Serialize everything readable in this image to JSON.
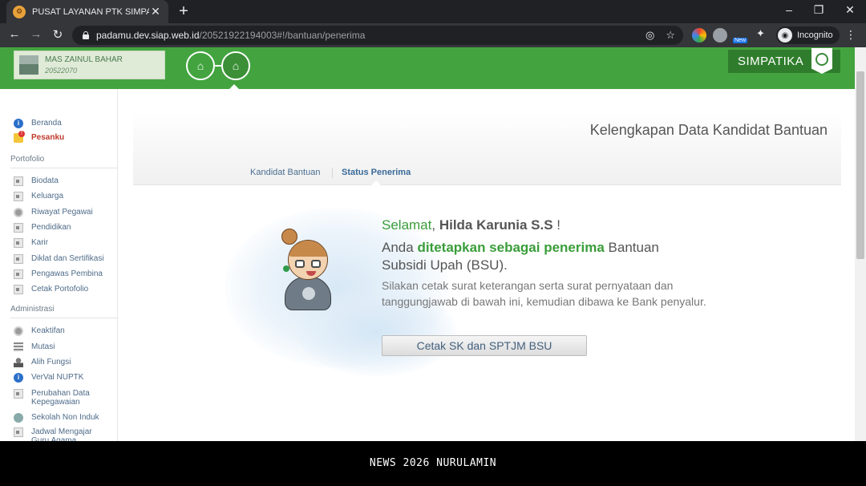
{
  "browser": {
    "tab_title": "PUSAT LAYANAN PTK SIMPATIKA",
    "favicon": "simpatika-favicon",
    "url_host": "padamu.dev.siap.web.id",
    "url_path": "/20521922194003#!/bantuan/penerima",
    "ext_badge": "New",
    "incognito_label": "Incognito"
  },
  "header": {
    "user_name": "MAS ZAINUL BAHAR",
    "user_id": "20522070",
    "brand": "SIMPATIKA"
  },
  "sidebar": {
    "top_items": [
      {
        "label": "Beranda",
        "icon": "info-icon"
      },
      {
        "label": "Pesanku",
        "icon": "message-icon"
      }
    ],
    "portfolio_heading": "Portofolio",
    "portfolio_items": [
      {
        "label": "Biodata"
      },
      {
        "label": "Keluarga"
      },
      {
        "label": "Riwayat Pegawai"
      },
      {
        "label": "Pendidikan"
      },
      {
        "label": "Karir"
      },
      {
        "label": "Diklat dan Sertifikasi"
      },
      {
        "label": "Pengawas Pembina"
      },
      {
        "label": "Cetak Portofolio"
      }
    ],
    "admin_heading": "Administrasi",
    "admin_items": [
      {
        "label": "Keaktifan"
      },
      {
        "label": "Mutasi"
      },
      {
        "label": "Alih Fungsi"
      },
      {
        "label": "VerVal NUPTK"
      },
      {
        "label": "Perubahan Data Kepegawaian"
      },
      {
        "label": "Sekolah Non Induk"
      },
      {
        "label": "Jadwal Mengajar Guru Agama"
      }
    ]
  },
  "main": {
    "panel_title": "Kelengkapan Data Kandidat Bantuan",
    "tabs": [
      {
        "label": "Kandidat Bantuan"
      },
      {
        "label": "Status Penerima"
      }
    ],
    "greeting_word": "Selamat",
    "greeting_sep": ", ",
    "recipient_name": "Hilda Karunia S.S",
    "greeting_end": " !",
    "line2_a": "Anda ",
    "line2_highlight": "ditetapkan sebagai penerima",
    "line2_b": " Bantuan Subsidi Upah (BSU).",
    "description": "Silakan cetak surat keterangan serta surat pernyataan dan tanggungjawab di bawah ini, kemudian dibawa ke Bank penyalur.",
    "print_button": "Cetak SK dan SPTJM BSU"
  },
  "watermark": "NEWS 2026 NURULAMIN",
  "colors": {
    "brand_green": "#43a43f",
    "accent_green": "#3a9d3a",
    "link_blue": "#4a6e91"
  }
}
